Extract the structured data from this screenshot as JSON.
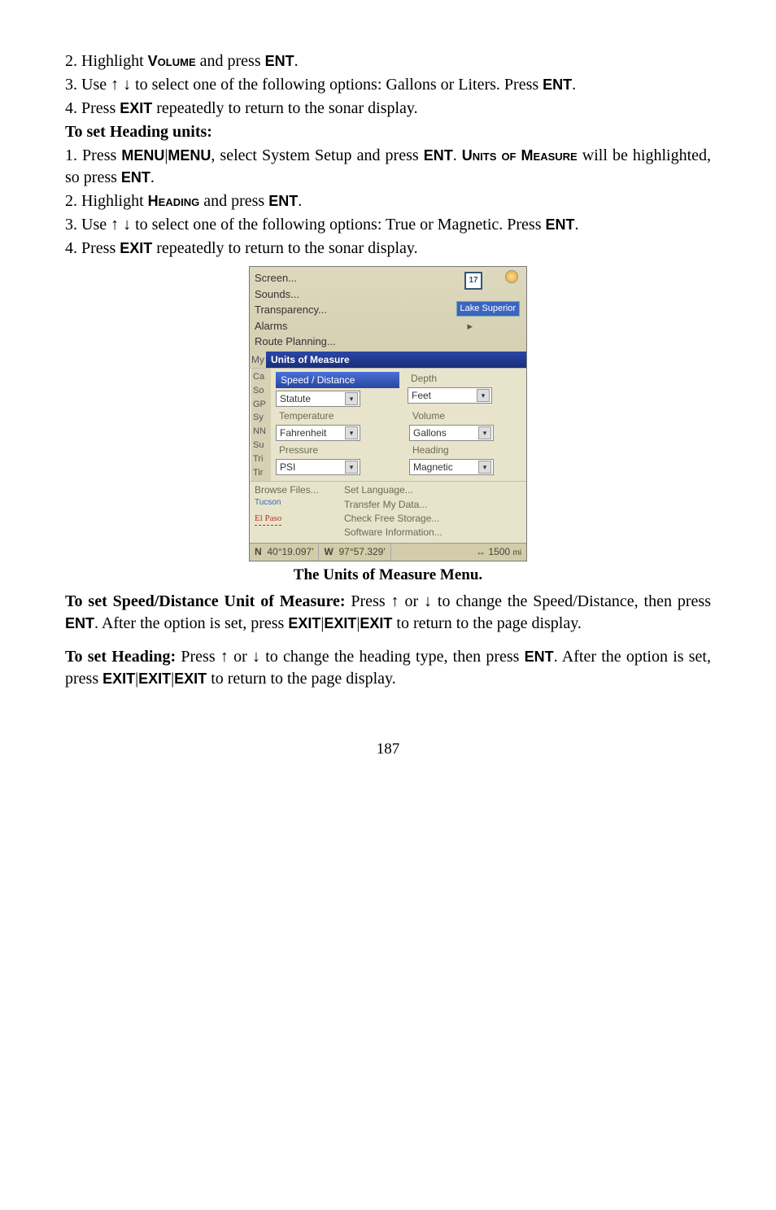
{
  "body": {
    "p1_a": "2. Highlight ",
    "p1_b": "Volume",
    "p1_c": " and press ",
    "p1_d": "ENT",
    "p1_e": ".",
    "p2_a": "3. Use ",
    "p2_b": "↑ ↓",
    "p2_c": " to select one of the following options: Gallons or Liters. Press ",
    "p2_d": "ENT",
    "p2_e": ".",
    "p3_a": "4. Press ",
    "p3_b": "EXIT",
    "p3_c": " repeatedly to return to the sonar display.",
    "h1": "To set Heading units:",
    "p4_a": "1. Press ",
    "p4_b": "MENU",
    "p4_c": "|",
    "p4_d": "MENU",
    "p4_e": ", select System Setup and press ",
    "p4_f": "ENT",
    "p4_g": ". ",
    "p4_h": "Units of Measure",
    "p4_i": " will be highlighted, so press ",
    "p4_j": "ENT",
    "p4_k": ".",
    "p5_a": "2. Highlight ",
    "p5_b": "Heading",
    "p5_c": " and press ",
    "p5_d": "ENT",
    "p5_e": ".",
    "p6_a": "3. Use ",
    "p6_b": "↑ ↓",
    "p6_c": " to select one of the following options: True or Magnetic. Press ",
    "p6_d": "ENT",
    "p6_e": ".",
    "p7_a": "4. Press ",
    "p7_b": "EXIT",
    "p7_c": " repeatedly to return to the sonar display.",
    "caption": "The Units of Measure Menu.",
    "p8_a": "To set Speed/Distance Unit of Measure:",
    "p8_b": " Press ",
    "p8_c": "↑",
    "p8_d": " or ",
    "p8_e": "↓",
    "p8_f": " to change the Speed/Distance, then press ",
    "p8_g": "ENT",
    "p8_h": ". After the option is set, press ",
    "p8_i": "EXIT",
    "p8_j": "|",
    "p8_k": "EXIT",
    "p8_l": "|",
    "p8_m": "EXIT",
    "p8_n": " to return to the page display.",
    "p9_a": "To set Heading:",
    "p9_b": " Press ",
    "p9_c": "↑",
    "p9_d": " or ",
    "p9_e": "↓",
    "p9_f": " to change the heading type, then press ",
    "p9_g": "ENT",
    "p9_h": ". After the option is set, press ",
    "p9_i": "EXIT",
    "p9_j": "|",
    "p9_k": "EXIT",
    "p9_l": "|",
    "p9_m": "EXIT",
    "p9_n": " to return to the page display.",
    "pagenum": "187"
  },
  "shot": {
    "menu": {
      "screen": "Screen...",
      "sounds": "Sounds...",
      "transparency": "Transparency...",
      "alarms": "Alarms",
      "route": "Route Planning...",
      "my_prefix": "My",
      "units_bar": "Units of Measure",
      "hwy": "17",
      "lake": "Lake Superior"
    },
    "left_letters": {
      "ca": "Ca",
      "so": "So",
      "gp": "GP",
      "sy": "Sy",
      "nn": "NN",
      "su": "Su",
      "tri": "Tri",
      "tir": "Tir"
    },
    "panel": {
      "speed_hdr": "Speed / Distance",
      "depth_lbl": "Depth",
      "statute": "Statute",
      "feet": "Feet",
      "temp_lbl": "Temperature",
      "volume_lbl": "Volume",
      "fahrenheit": "Fahrenheit",
      "gallons": "Gallons",
      "pressure_lbl": "Pressure",
      "heading_lbl": "Heading",
      "psi": "PSI",
      "magnetic": "Magnetic"
    },
    "bottom": {
      "browse": "Browse Files...",
      "tucson": "Tucson",
      "elpaso": "El Paso",
      "setlang": "Set Language...",
      "transfer": "Transfer My Data...",
      "check": "Check Free Storage...",
      "swinfo": "Software Information..."
    },
    "status": {
      "n": "N",
      "lat": "40°19.097'",
      "w": "W",
      "lon": "97°57.329'",
      "dist_arrow": "↔",
      "dist_val": "1500",
      "dist_unit": "mi"
    }
  }
}
